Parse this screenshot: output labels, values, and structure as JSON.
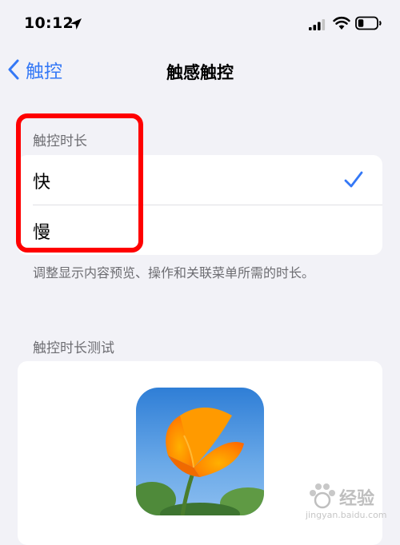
{
  "status_bar": {
    "time": "10:12",
    "icons": [
      "location-arrow-icon",
      "cellular-signal-icon",
      "wifi-icon",
      "battery-icon"
    ]
  },
  "nav": {
    "back_label": "触控",
    "title": "触感触控"
  },
  "duration_section": {
    "header": "触控时长",
    "options": [
      {
        "label": "快",
        "selected": true
      },
      {
        "label": "慢",
        "selected": false
      }
    ],
    "footer": "调整显示内容预览、操作和关联菜单所需的时长。"
  },
  "test_section": {
    "header": "触控时长测试",
    "image": "orange-poppy-flower-photo"
  },
  "watermark": {
    "main": "经验",
    "sub": "jingyan.baidu.com"
  },
  "colors": {
    "accent": "#3478f6",
    "highlight": "#ff0000",
    "background": "#f2f2f7"
  }
}
